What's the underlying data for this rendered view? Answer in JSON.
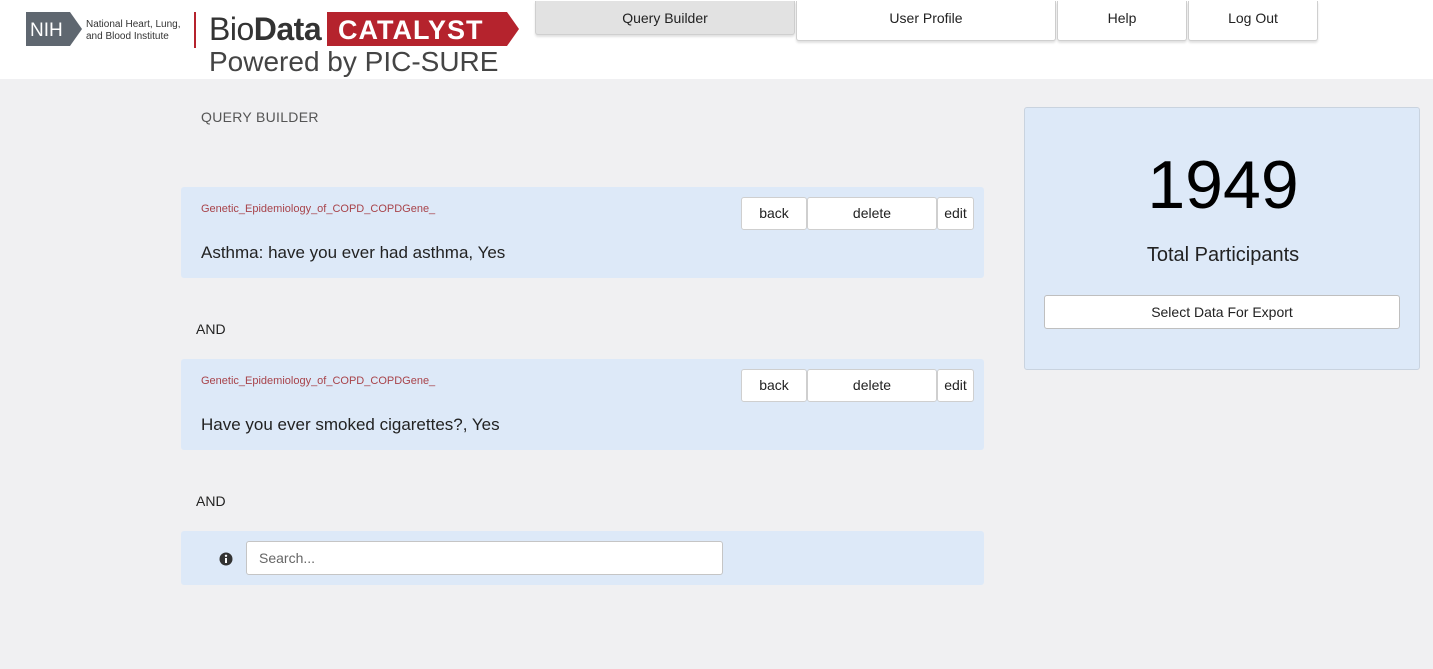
{
  "header": {
    "nih_badge": "NIH",
    "nih_institute": "National Heart, Lung, and Blood Institute",
    "brand_bio_light": "Bio",
    "brand_bio_bold": "Data",
    "brand_catalyst": "CATALYST",
    "brand_powered": "Powered by PIC-SURE",
    "brand_color": "#b5232d"
  },
  "nav": {
    "tabs": [
      {
        "label": "Query Builder",
        "active": true
      },
      {
        "label": "User Profile",
        "active": false
      },
      {
        "label": "Help",
        "active": false
      },
      {
        "label": "Log Out",
        "active": false
      }
    ]
  },
  "query_builder": {
    "title": "QUERY BUILDER",
    "filters": [
      {
        "study": "Genetic_Epidemiology_of_COPD_COPDGene_",
        "description": "Asthma: have you ever had asthma, Yes",
        "back_label": "back",
        "delete_label": "delete",
        "edit_label": "edit"
      },
      {
        "study": "Genetic_Epidemiology_of_COPD_COPDGene_",
        "description": "Have you ever smoked cigarettes?, Yes",
        "back_label": "back",
        "delete_label": "delete",
        "edit_label": "edit"
      }
    ],
    "operators": [
      "AND",
      "AND"
    ],
    "search": {
      "placeholder": "Search...",
      "value": "",
      "info_icon": "info-circle-icon"
    }
  },
  "summary": {
    "total_count": "1949",
    "count_label": "Total Participants",
    "export_label": "Select Data For Export"
  }
}
